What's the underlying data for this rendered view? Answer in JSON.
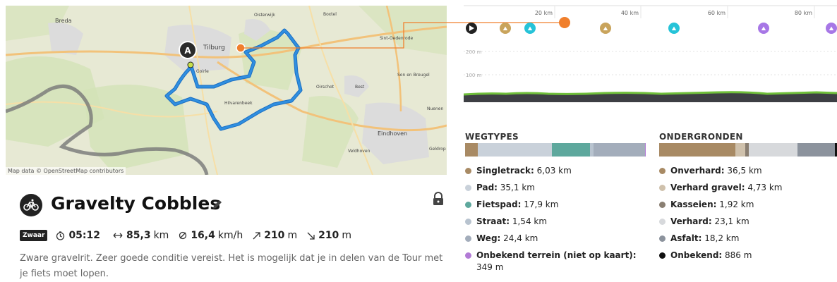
{
  "map": {
    "credit": "Map data © OpenStreetMap contributors",
    "start_marker": "A",
    "places": [
      "Breda",
      "Tilburg",
      "Oisterwijk",
      "Boxtel",
      "Sint-Oedenrode",
      "Son en Breugel",
      "Goirle",
      "Hilvarenbeek",
      "Oirschot",
      "Best",
      "Eindhoven",
      "Veldhoven",
      "Nuenen",
      "Geldrop"
    ]
  },
  "tour": {
    "icon": "gravel-bike-icon",
    "title": "Gravelty Cobbles",
    "difficulty": "Zwaar",
    "duration": "05:12",
    "distance_value": "85,3",
    "distance_unit": "km",
    "speed_value": "16,4",
    "speed_unit": "km/h",
    "ascent_value": "210",
    "ascent_unit": "m",
    "descent_value": "210",
    "descent_unit": "m",
    "description": "Zware gravelrit. Zeer goede conditie vereist. Het is mogelijk dat je in delen van de Tour met je fiets moet lopen."
  },
  "elevation": {
    "km_ticks": [
      "20 km",
      "40 km",
      "60 km",
      "80 km"
    ],
    "alt_ticks": [
      "200 m",
      "100 m"
    ],
    "waypoint_colors": {
      "start": "#222222",
      "gravel": "#c9a45c",
      "bike": "#26c3d8",
      "unknown": "#a777e6"
    }
  },
  "wegtypes": {
    "title": "WEGTYPES",
    "items": [
      {
        "name": "Singletrack:",
        "value": "6,03 km",
        "color": "#a88a64",
        "share": 0.0707
      },
      {
        "name": "Pad:",
        "value": "35,1 km",
        "color": "#c9d1da",
        "share": 0.4115
      },
      {
        "name": "Fietspad:",
        "value": "17,9 km",
        "color": "#5ea89d",
        "share": 0.2098
      },
      {
        "name": "Straat:",
        "value": "1,54 km",
        "color": "#b8c3cf",
        "share": 0.0181
      },
      {
        "name": "Weg:",
        "value": "24,4 km",
        "color": "#a3adbb",
        "share": 0.286
      },
      {
        "name": "Onbekend terrein (niet op kaart):",
        "value": "349 m",
        "color": "#b27bd6",
        "share": 0.0041
      }
    ]
  },
  "ondergronden": {
    "title": "ONDERGRONDEN",
    "items": [
      {
        "name": "Onverhard:",
        "value": "36,5 km",
        "color": "#a88a64",
        "share": 0.4279
      },
      {
        "name": "Verhard gravel:",
        "value": "4,73 km",
        "color": "#cfc1ac",
        "share": 0.0555
      },
      {
        "name": "Kasseien:",
        "value": "1,92 km",
        "color": "#8a7f72",
        "share": 0.0225
      },
      {
        "name": "Verhard:",
        "value": "23,1 km",
        "color": "#d7d9dc",
        "share": 0.2708
      },
      {
        "name": "Asfalt:",
        "value": "18,2 km",
        "color": "#8c939d",
        "share": 0.2134
      },
      {
        "name": "Onbekend:",
        "value": "886 m",
        "color": "#111111",
        "share": 0.0104
      }
    ]
  }
}
